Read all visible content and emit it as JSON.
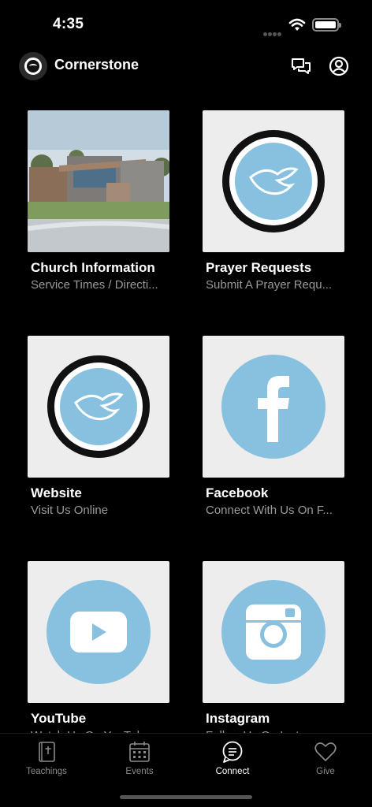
{
  "status": {
    "time": "4:35"
  },
  "header": {
    "title": "Cornerstone"
  },
  "tiles": [
    {
      "title": "Church Information",
      "subtitle": "Service Times / Directi..."
    },
    {
      "title": "Prayer Requests",
      "subtitle": "Submit A Prayer Requ..."
    },
    {
      "title": "Website",
      "subtitle": "Visit Us Online"
    },
    {
      "title": "Facebook",
      "subtitle": "Connect With Us On F..."
    },
    {
      "title": "YouTube",
      "subtitle": "Watch Us On YouTube"
    },
    {
      "title": "Instagram",
      "subtitle": "Follow Us On Instagram"
    }
  ],
  "tabs": [
    {
      "label": "Teachings",
      "icon": "bible-icon"
    },
    {
      "label": "Events",
      "icon": "calendar-icon"
    },
    {
      "label": "Connect",
      "icon": "chat-bubble-icon",
      "active": true
    },
    {
      "label": "Give",
      "icon": "heart-icon"
    }
  ],
  "colors": {
    "accent_blue": "#87c1df",
    "background": "#000000",
    "muted_text": "#9a9a9a"
  }
}
